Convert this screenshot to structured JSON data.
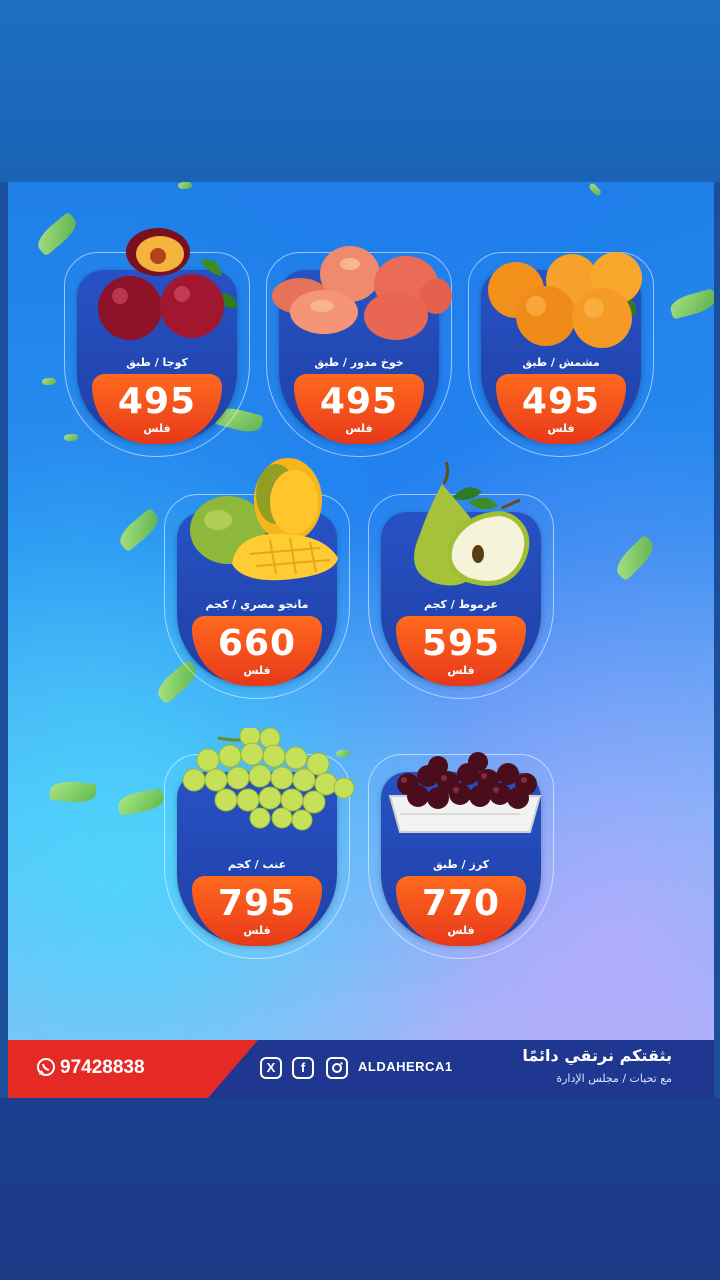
{
  "products": [
    {
      "name": "مشمش / طبق",
      "price": "495",
      "currency": "فلس",
      "fruit": "apricot"
    },
    {
      "name": "خوخ مدور / طبق",
      "price": "495",
      "currency": "فلس",
      "fruit": "flat-peach"
    },
    {
      "name": "كوجا / طبق",
      "price": "495",
      "currency": "فلس",
      "fruit": "plum"
    },
    {
      "name": "عرموط / كجم",
      "price": "595",
      "currency": "فلس",
      "fruit": "pear"
    },
    {
      "name": "مانجو مصري / كجم",
      "price": "660",
      "currency": "فلس",
      "fruit": "mango"
    },
    {
      "name": "كرز / طبق",
      "price": "770",
      "currency": "فلس",
      "fruit": "cherry"
    },
    {
      "name": "عنب / كجم",
      "price": "795",
      "currency": "فلس",
      "fruit": "grapes"
    }
  ],
  "footer": {
    "phone": "97428838",
    "handle": "ALDAHERCA1",
    "slogan": "بثقتكم نرتقي دائمًا",
    "subslogan": "مع تحيات / مجلس الإدارة",
    "social_icons": [
      "x-icon",
      "facebook-icon",
      "instagram-icon",
      "whatsapp-icon"
    ]
  },
  "colors": {
    "price_tag": "#e8381a",
    "card_panel": "#2349b8",
    "footer_blue": "#1f3790",
    "footer_red": "#e52a25"
  }
}
